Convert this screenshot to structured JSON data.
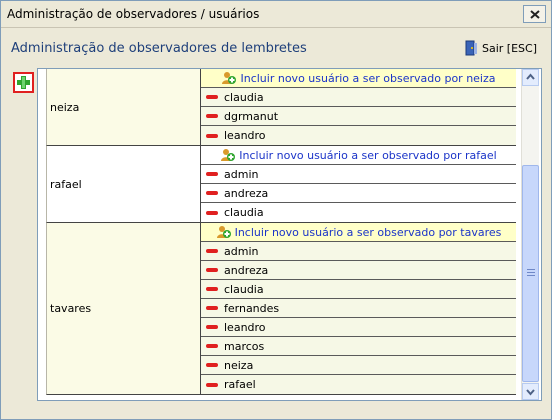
{
  "window": {
    "title": "Administração de observadores / usuários"
  },
  "header": {
    "subtitle": "Administração de observadores de lembretes",
    "exit_label": "Sair [ESC]"
  },
  "groups": [
    {
      "observer": "neiza",
      "include_label": "Incluir novo usuário a ser observado por neiza",
      "users": [
        "claudia",
        "dgrmanut",
        "leandro"
      ]
    },
    {
      "observer": "rafael",
      "include_label": "Incluir novo usuário a ser observado por rafael",
      "users": [
        "admin",
        "andreza",
        "claudia"
      ]
    },
    {
      "observer": "tavares",
      "include_label": "Incluir novo usuário a ser observado por tavares",
      "users": [
        "admin",
        "andreza",
        "claudia",
        "fernandes",
        "leandro",
        "marcos",
        "neiza",
        "rafael"
      ]
    }
  ],
  "icons": {
    "add": "plus-icon",
    "exit": "door-exit-icon",
    "include": "add-user-icon",
    "remove": "minus-icon"
  },
  "colors": {
    "accent_red": "#e02020",
    "link_blue": "#1b34c8"
  }
}
